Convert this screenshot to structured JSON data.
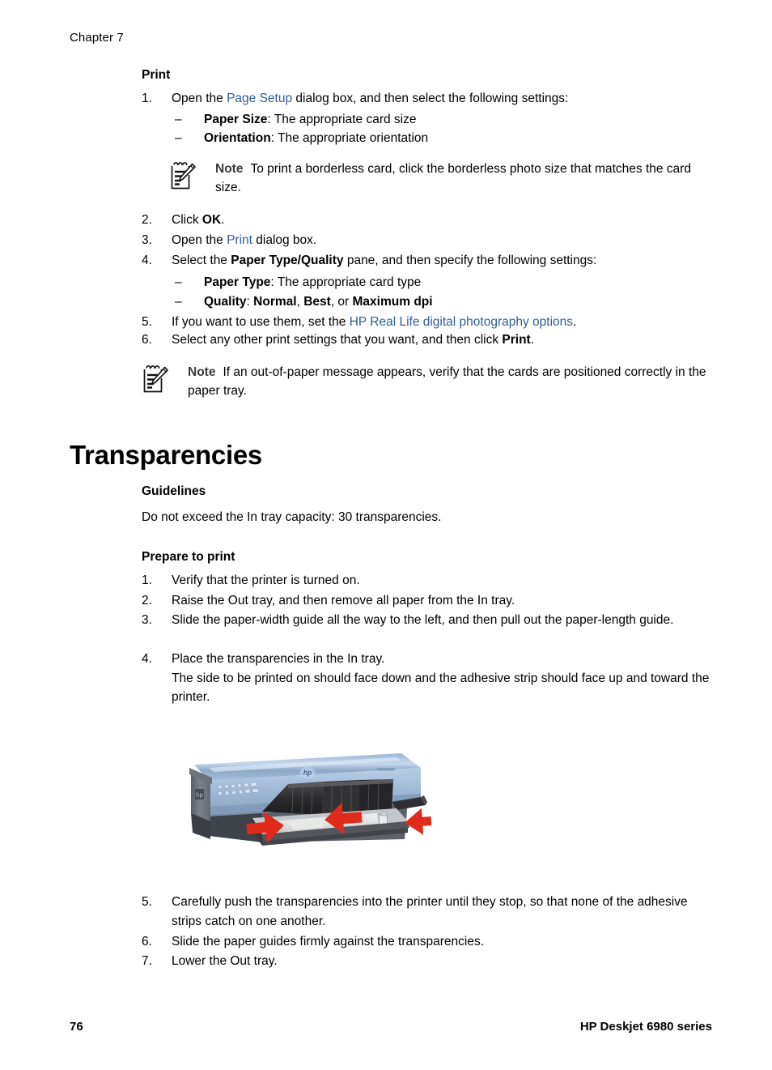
{
  "header": {
    "chapter": "Chapter 7"
  },
  "print_section": {
    "heading": "Print",
    "steps": [
      {
        "num": "1.",
        "parts": [
          {
            "t": "Open the ",
            "s": "n"
          },
          {
            "t": "Page Setup",
            "s": "link"
          },
          {
            "t": " dialog box, and then select the following settings:",
            "s": "n"
          }
        ]
      },
      {
        "num": "2.",
        "parts": [
          {
            "t": "Click ",
            "s": "n"
          },
          {
            "t": "OK",
            "s": "b"
          },
          {
            "t": ".",
            "s": "n"
          }
        ]
      },
      {
        "num": "3.",
        "parts": [
          {
            "t": "Open the ",
            "s": "n"
          },
          {
            "t": "Print",
            "s": "link"
          },
          {
            "t": " dialog box.",
            "s": "n"
          }
        ]
      },
      {
        "num": "4.",
        "parts": [
          {
            "t": "Select the ",
            "s": "n"
          },
          {
            "t": "Paper Type/Quality",
            "s": "b"
          },
          {
            "t": " pane, and then specify the following settings:",
            "s": "n"
          }
        ]
      },
      {
        "num": "5.",
        "parts": [
          {
            "t": "If you want to use them, set the ",
            "s": "n"
          },
          {
            "t": "HP Real Life digital photography options",
            "s": "link"
          },
          {
            "t": ".",
            "s": "n"
          }
        ]
      },
      {
        "num": "6.",
        "parts": [
          {
            "t": "Select any other print settings that you want, and then click ",
            "s": "n"
          },
          {
            "t": "Print",
            "s": "b"
          },
          {
            "t": ".",
            "s": "n"
          }
        ]
      }
    ],
    "sub_items_1": [
      {
        "dash": "–",
        "parts": [
          {
            "t": "Paper Size",
            "s": "b"
          },
          {
            "t": ": The appropriate card size",
            "s": "n"
          }
        ]
      },
      {
        "dash": "–",
        "parts": [
          {
            "t": "Orientation",
            "s": "b"
          },
          {
            "t": ": The appropriate orientation",
            "s": "n"
          }
        ]
      }
    ],
    "sub_items_4": [
      {
        "dash": "–",
        "parts": [
          {
            "t": "Paper Type",
            "s": "b"
          },
          {
            "t": ": The appropriate card type",
            "s": "n"
          }
        ]
      },
      {
        "dash": "–",
        "parts": [
          {
            "t": "Quality",
            "s": "b"
          },
          {
            "t": ": ",
            "s": "n"
          },
          {
            "t": "Normal",
            "s": "b"
          },
          {
            "t": ", ",
            "s": "n"
          },
          {
            "t": "Best",
            "s": "b"
          },
          {
            "t": ", or ",
            "s": "n"
          },
          {
            "t": "Maximum dpi",
            "s": "b"
          }
        ]
      }
    ],
    "note_1": {
      "label": "Note",
      "text": "To print a borderless card, click the borderless photo size that matches the card size.",
      "icon": "note-pad-pencil-icon"
    },
    "note_2": {
      "label": "Note",
      "text": "If an out-of-paper message appears, verify that the cards are positioned correctly in the paper tray.",
      "icon": "note-pad-pencil-icon"
    }
  },
  "transparencies_section": {
    "heading": "Transparencies",
    "guidelines": {
      "heading": "Guidelines",
      "text": "Do not exceed the In tray capacity: 30 transparencies."
    },
    "prepare": {
      "heading": "Prepare to print",
      "steps": [
        {
          "num": "1.",
          "text": "Verify that the printer is turned on."
        },
        {
          "num": "2.",
          "text": "Raise the Out tray, and then remove all paper from the In tray."
        },
        {
          "num": "3.",
          "text": "Slide the paper-width guide all the way to the left, and then pull out the paper-length guide."
        },
        {
          "num": "4.",
          "text": "Place the transparencies in the In tray."
        }
      ],
      "step4_note": "The side to be printed on should face down and the adhesive strip should face up and toward the printer.",
      "steps_after": [
        {
          "num": "5.",
          "text": "Carefully push the transparencies into the printer until they stop, so that none of the adhesive strips catch on one another."
        },
        {
          "num": "6.",
          "text": "Slide the paper guides firmly against the transparencies."
        },
        {
          "num": "7.",
          "text": "Lower the Out tray."
        }
      ]
    },
    "figure": {
      "name": "hp-deskjet-printer-illustration",
      "description": "HP Deskjet printer with In tray extended and three red arrows indicating paper guides",
      "colors": {
        "body_light": "#a9c2de",
        "body_top": "#8fa9c9",
        "side_panel": "#6b7078",
        "tray_dark": "#2b2b2d",
        "arrow_red": "#e02b1c"
      }
    }
  },
  "footer": {
    "page_number": "76",
    "series": "HP Deskjet 6980 series"
  },
  "colors": {
    "link": "#2f5e96",
    "text": "#000000",
    "note_label": "#3a3a3a",
    "page_bg": "#ffffff"
  }
}
